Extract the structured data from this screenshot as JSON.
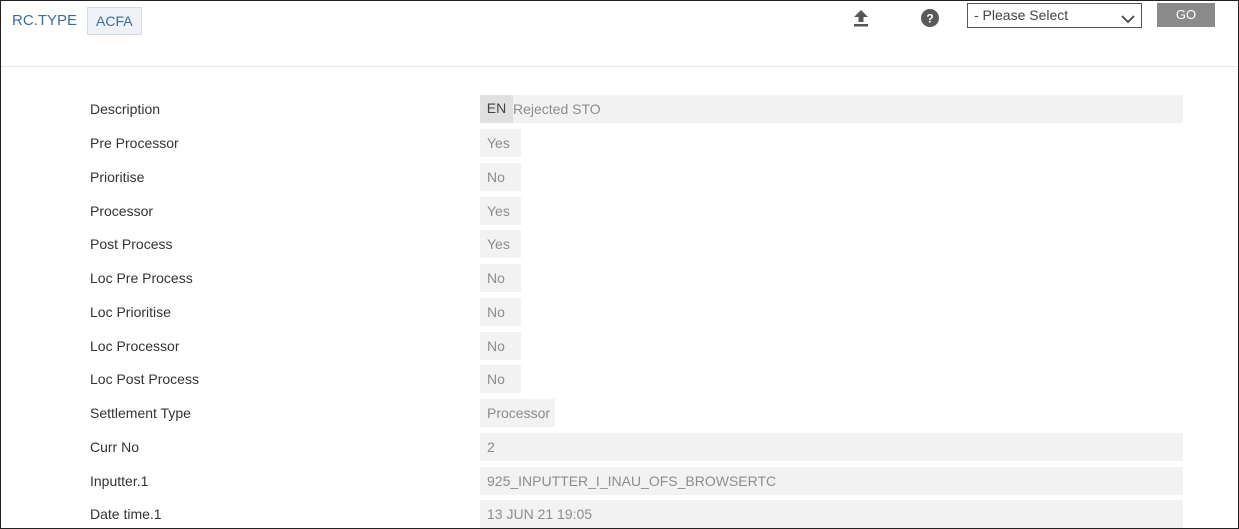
{
  "header": {
    "app_title": "RC.TYPE",
    "record_id": "ACFA",
    "icons": {
      "upload": "upload-icon",
      "help": "help-icon"
    },
    "select_value": "- Please Select",
    "go_label": "GO"
  },
  "fields": [
    {
      "label": "Description",
      "lang": "EN",
      "value": "Rejected STO"
    },
    {
      "label": "Pre Processor",
      "value": "Yes"
    },
    {
      "label": "Prioritise",
      "value": "No"
    },
    {
      "label": "Processor",
      "value": "Yes"
    },
    {
      "label": "Post Process",
      "value": "Yes"
    },
    {
      "label": "Loc Pre Process",
      "value": "No"
    },
    {
      "label": "Loc Prioritise",
      "value": "No"
    },
    {
      "label": "Loc Processor",
      "value": "No"
    },
    {
      "label": "Loc Post Process",
      "value": "No"
    },
    {
      "label": "Settlement Type",
      "value": "Processor"
    },
    {
      "label": "Curr No",
      "value": "2"
    },
    {
      "label": "Inputter.1",
      "value": "925_INPUTTER_I_INAU_OFS_BROWSERTC"
    },
    {
      "label": "Date time.1",
      "value": "13 JUN 21 19:05"
    }
  ],
  "colors": {
    "link": "#3a6d9a",
    "go_button": "#8a8a8a",
    "value_bg": "#f2f2f2"
  }
}
